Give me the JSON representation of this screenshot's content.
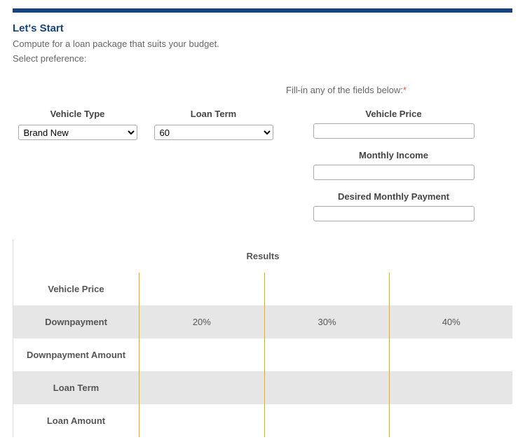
{
  "title": "Let's Start",
  "subtitle1": "Compute for a loan package that suits your budget.",
  "subtitle2": "Select preference:",
  "fill_in_label": "Fill-in any of the fields below:",
  "asterisk": "*",
  "fields": {
    "vehicle_type": {
      "label": "Vehicle Type",
      "value": "Brand New"
    },
    "loan_term": {
      "label": "Loan Term",
      "value": "60"
    },
    "vehicle_price": {
      "label": "Vehicle Price",
      "value": ""
    },
    "monthly_income": {
      "label": "Monthly Income",
      "value": ""
    },
    "desired_monthly": {
      "label": "Desired Monthly Payment",
      "value": ""
    }
  },
  "results": {
    "header": "Results",
    "rows": [
      {
        "label": "Vehicle Price",
        "cols": [
          "",
          "",
          ""
        ],
        "alt": false
      },
      {
        "label": "Downpayment",
        "cols": [
          "20%",
          "30%",
          "40%"
        ],
        "alt": true
      },
      {
        "label": "Downpayment Amount",
        "cols": [
          "",
          "",
          ""
        ],
        "alt": false
      },
      {
        "label": "Loan Term",
        "cols": [
          "",
          "",
          ""
        ],
        "alt": true
      },
      {
        "label": "Loan Amount",
        "cols": [
          "",
          "",
          ""
        ],
        "alt": false
      }
    ]
  }
}
